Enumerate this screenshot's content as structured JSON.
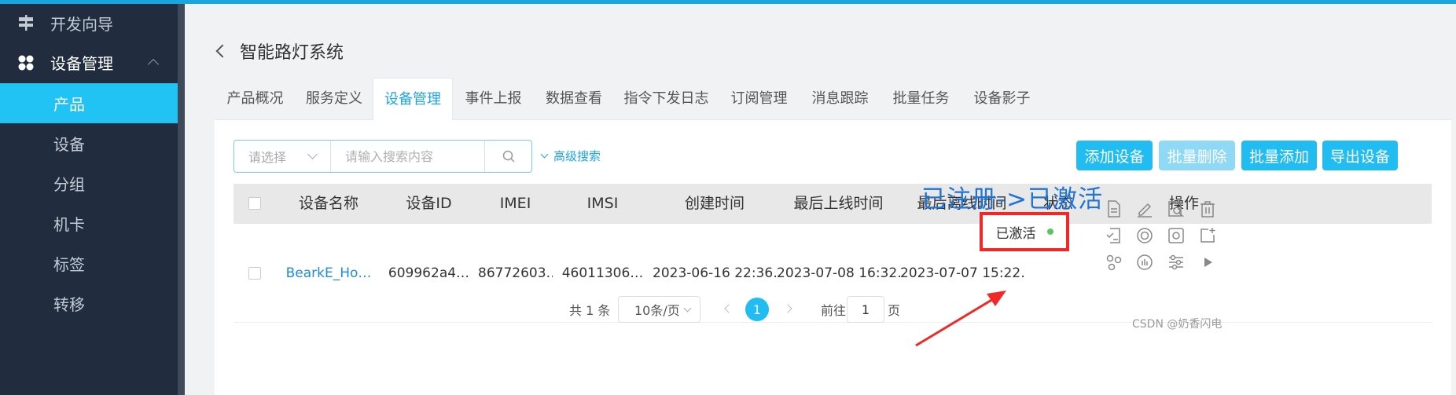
{
  "sidebar": {
    "items": [
      {
        "label": "开发向导",
        "icon": "signpost-icon"
      },
      {
        "label": "设备管理",
        "icon": "grid-icon"
      },
      {
        "label": "产品"
      },
      {
        "label": "设备"
      },
      {
        "label": "分组"
      },
      {
        "label": "机卡"
      },
      {
        "label": "标签"
      },
      {
        "label": "转移"
      }
    ]
  },
  "header": {
    "title": "智能路灯系统"
  },
  "tabs": [
    "产品概况",
    "服务定义",
    "设备管理",
    "事件上报",
    "数据查看",
    "指令下发日志",
    "订阅管理",
    "消息跟踪",
    "批量任务",
    "设备影子"
  ],
  "search": {
    "select_placeholder": "请选择",
    "placeholder": "请输入搜索内容",
    "advanced": "高级搜索"
  },
  "actions": {
    "add": "添加设备",
    "batch_delete": "批量删除",
    "batch_add": "批量添加",
    "export": "导出设备"
  },
  "table": {
    "columns": [
      "设备名称",
      "设备ID",
      "IMEI",
      "IMSI",
      "创建时间",
      "最后上线时间",
      "最后离线时间",
      "状态",
      "操作"
    ],
    "rows": [
      {
        "name": "BearkE_Ho…",
        "id": "609962a4…",
        "imei": "86772603…",
        "imsi": "46011306…",
        "created": "2023-06-16 22:36…",
        "last_online": "2023-07-08 16:32…",
        "last_offline": "2023-07-07 15:22…",
        "status": "已激活"
      }
    ]
  },
  "annotation": "已注册->已激活",
  "pagination": {
    "total": "共 1 条",
    "page_size": "10条/页",
    "current": "1",
    "goto_label": "前往",
    "goto_value": "1",
    "page_suffix": "页"
  },
  "watermark": "CSDN @奶香闪电",
  "colors": {
    "accent": "#21bdf2",
    "sidebar_bg": "#212d3f",
    "active": "#21c3f4",
    "status_ok": "#5cc561",
    "annotation": "#1f74d9",
    "highlight": "#f02828"
  }
}
